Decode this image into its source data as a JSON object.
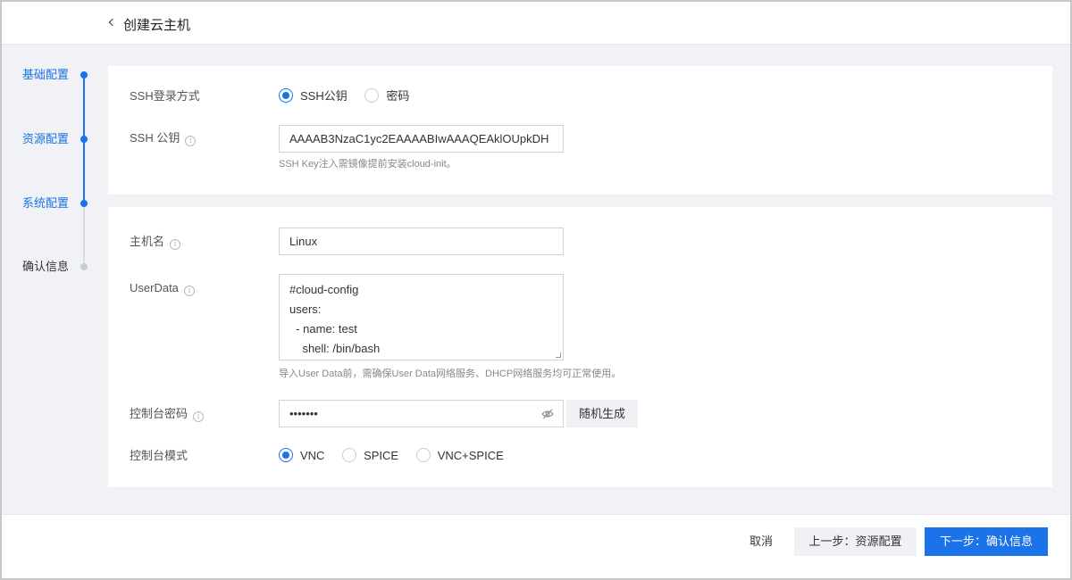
{
  "header": {
    "title": "创建云主机"
  },
  "steps": [
    {
      "label": "基础配置",
      "state": "done"
    },
    {
      "label": "资源配置",
      "state": "done"
    },
    {
      "label": "系统配置",
      "state": "current"
    },
    {
      "label": "确认信息",
      "state": "pending"
    }
  ],
  "ssh": {
    "login_label": "SSH登录方式",
    "options": [
      "SSH公钥",
      "密码"
    ],
    "selected": "SSH公钥",
    "key_label": "SSH 公钥",
    "key_value": "AAAAB3NzaC1yc2EAAAABIwAAAQEAklOUpkDH",
    "key_hint": "SSH Key注入需镜像提前安装cloud-init。"
  },
  "system": {
    "hostname_label": "主机名",
    "hostname_value": "Linux",
    "userdata_label": "UserData",
    "userdata_lines": [
      "#cloud-config",
      "users:",
      "  - name: test",
      "    shell: /bin/bash"
    ],
    "userdata_hint": "导入User Data前，需确保User Data网络服务、DHCP网络服务均可正常使用。",
    "console_pwd_label": "控制台密码",
    "console_pwd_value": "•••••••",
    "random_btn": "随机生成",
    "console_mode_label": "控制台模式",
    "console_modes": [
      "VNC",
      "SPICE",
      "VNC+SPICE"
    ],
    "console_mode_selected": "VNC"
  },
  "footer": {
    "cancel": "取消",
    "prev": "上一步：资源配置",
    "next": "下一步：确认信息"
  },
  "colors": {
    "accent": "#1a73e8",
    "background": "#f0f2f5"
  }
}
